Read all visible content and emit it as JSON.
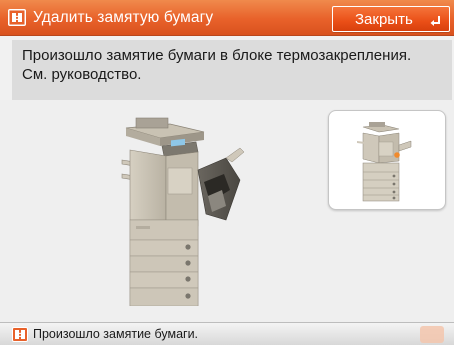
{
  "header": {
    "title": "Удалить замятую бумагу",
    "title_icon": "paper-jam-icon",
    "close_label": "Закрыть",
    "close_icon": "return-arrow-icon",
    "accent_color": "#e8612a"
  },
  "message": {
    "line1": "Произошло замятие бумаги в блоке термозакрепления.",
    "line2": "См. руководство."
  },
  "illustration": {
    "main": "copier-front-door-open-illustration",
    "thumbnail": "copier-jam-location-thumbnail",
    "jam_marker_color": "#f08a2c"
  },
  "status": {
    "text": "Произошло замятие бумаги.",
    "icon": "paper-jam-icon"
  }
}
